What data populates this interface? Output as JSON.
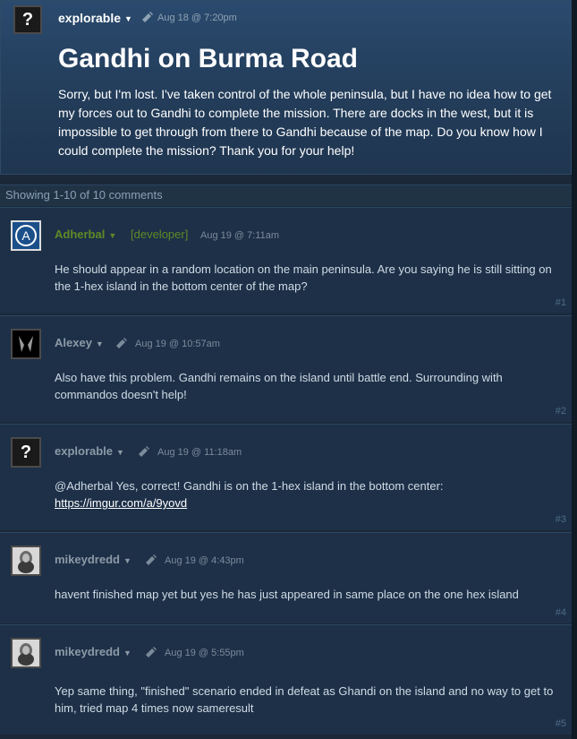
{
  "topic": {
    "author": "explorable",
    "date": "Aug 18 @ 7:20pm",
    "title": "Gandhi on Burma Road",
    "body": "Sorry, but I'm lost. I've taken control of the whole peninsula, but I have no idea how to get my forces out to Gandhi to complete the mission. There are docks in the west, but it is impossible to get through from there to Gandhi because of the map. Do you know how I could complete the mission? Thank you for your help!"
  },
  "showing": "Showing 1-10 of 10 comments",
  "comments": [
    {
      "author": "Adherbal",
      "tag": "[developer]",
      "date": "Aug 19 @ 7:11am",
      "text": "He should appear in a random location on the main peninsula. Are you saying he is still sitting on the 1-hex island in the bottom center of the map?",
      "num": "#1"
    },
    {
      "author": "Alexey",
      "date": "Aug 19 @ 10:57am",
      "text": "Also have this problem. Gandhi remains on the island until battle end. Surrounding with commandos doesn't help!",
      "num": "#2"
    },
    {
      "author": "explorable",
      "date": "Aug 19 @ 11:18am",
      "text": "@Adherbal Yes, correct! Gandhi is on the 1-hex island in the bottom center:",
      "link": "https://imgur.com/a/9yovd",
      "num": "#3"
    },
    {
      "author": "mikeydredd",
      "date": "Aug 19 @ 4:43pm",
      "text": "havent finished map yet but yes he has just appeared in same place on the one hex island",
      "num": "#4"
    },
    {
      "author": "mikeydredd",
      "date": "Aug 19 @ 5:55pm",
      "text": "Yep same thing, \"finished\" scenario ended in defeat as Ghandi on the island and no way to get to him, tried map 4 times now sameresult",
      "num": "#5"
    }
  ],
  "colors": {
    "background": "#1b2838",
    "developer": "#5f8a25"
  }
}
